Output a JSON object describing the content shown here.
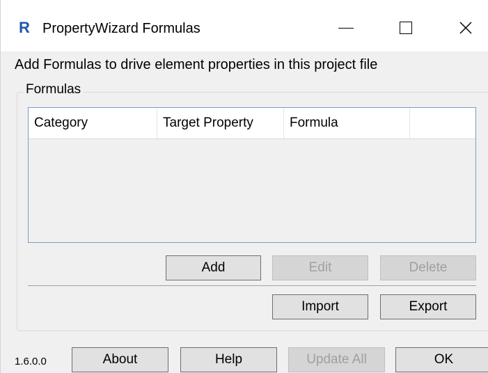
{
  "window": {
    "title": "PropertyWizard Formulas",
    "icon_letter": "R",
    "controls": {
      "minimize_glyph": "",
      "maximize_glyph": "",
      "close_glyph": "✕"
    }
  },
  "intro_text": "Add Formulas to drive element properties in this project file",
  "formulas_group": {
    "label": "Formulas",
    "columns": [
      "Category",
      "Target Property",
      "Formula",
      ""
    ],
    "rows": [],
    "buttons": {
      "add": "Add",
      "edit": "Edit",
      "delete": "Delete",
      "import": "Import",
      "export": "Export"
    }
  },
  "footer": {
    "version": "1.6.0.0",
    "about": "About",
    "help": "Help",
    "update_all": "Update All",
    "ok": "OK"
  },
  "colors": {
    "icon_blue": "#1f57a8",
    "list_border": "#7a9cc4",
    "disabled_text": "#a0a0a0"
  }
}
